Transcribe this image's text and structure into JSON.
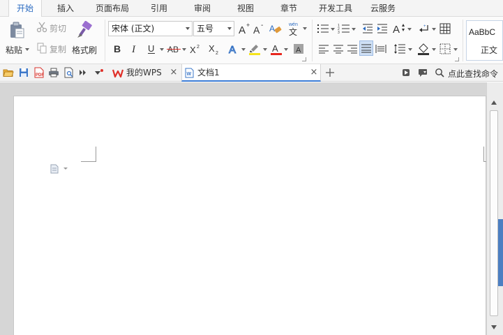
{
  "menu": {
    "tabs": [
      {
        "label": "开始",
        "active": true
      },
      {
        "label": "插入"
      },
      {
        "label": "页面布局"
      },
      {
        "label": "引用"
      },
      {
        "label": "审阅"
      },
      {
        "label": "视图"
      },
      {
        "label": "章节"
      },
      {
        "label": "开发工具"
      },
      {
        "label": "云服务"
      }
    ]
  },
  "ribbon": {
    "paste_label": "粘贴",
    "cut_label": "剪切",
    "copy_label": "复制",
    "format_painter_label": "格式刷",
    "font_name": "宋体 (正文)",
    "font_size": "五号",
    "style_sample": "AaBbC",
    "style_name": "正文",
    "colors": {
      "highlight": "#f5e31c",
      "font_color": "#e8261d",
      "accent": "#2b6bc1"
    }
  },
  "quickbar": {
    "doc_tabs": [
      {
        "label": "我的WPS",
        "icon": "wps-logo-icon"
      },
      {
        "label": "文档1",
        "icon": "document-icon",
        "active": true
      }
    ],
    "find_command_label": "点此查找命令"
  }
}
